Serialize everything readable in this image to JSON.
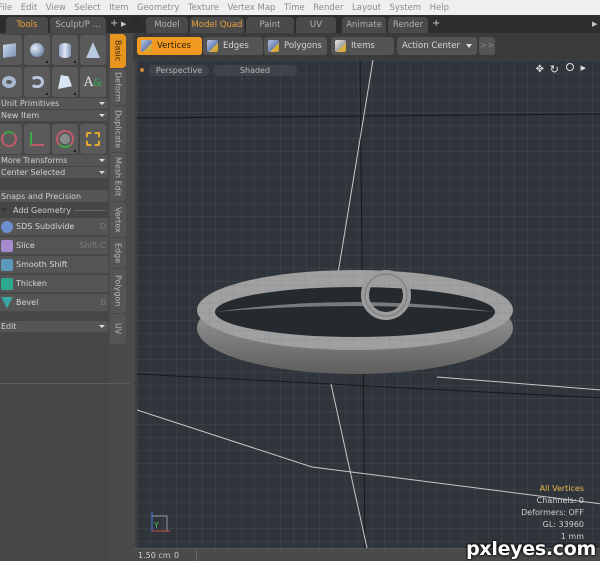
{
  "menubar": {
    "items": [
      "File",
      "Edit",
      "View",
      "Select",
      "Item",
      "Geometry",
      "Texture",
      "Vertex Map",
      "Time",
      "Render",
      "Layout",
      "System",
      "Help"
    ]
  },
  "left_tabs": {
    "items": [
      {
        "label": "Tools",
        "active": true
      },
      {
        "label": "Sculpt/P ...",
        "active": false
      }
    ]
  },
  "layout_tabs": {
    "items": [
      {
        "label": "Model",
        "active": false
      },
      {
        "label": "Model Quad",
        "active": true
      },
      {
        "label": "Paint",
        "active": false
      },
      {
        "label": "UV",
        "active": false
      },
      {
        "label": "Animate",
        "active": false
      },
      {
        "label": "Render",
        "active": false
      }
    ],
    "add_label": "+"
  },
  "toolbox": {
    "primitives_row1": [
      "cube-icon",
      "sphere-icon",
      "cylinder-icon",
      "cone-icon"
    ],
    "primitives_row2": [
      "torus-icon",
      "tube-icon",
      "pen-icon",
      "text-icon"
    ],
    "unit_primitives": "Unit Primitives",
    "new_item": "New Item",
    "transforms_row": [
      "move-icon",
      "transform-icon",
      "rotate-icon",
      "scale-icon"
    ],
    "more_transforms": "More Transforms",
    "center_selected": "Center Selected",
    "snaps_label": "Snaps and Precision",
    "add_geometry_label": "Add Geometry",
    "tools": [
      {
        "label": "SDS Subdivide",
        "key": "D",
        "color": "#6c8fd0"
      },
      {
        "label": "Slice",
        "key": "Shift-C",
        "color": "#a58ad0"
      },
      {
        "label": "Smooth Shift",
        "key": "",
        "color": "#5a9ab8"
      },
      {
        "label": "Thicken",
        "key": "",
        "color": "#2fa890"
      },
      {
        "label": "Bevel",
        "key": "B",
        "color": "#3aa8a8"
      }
    ],
    "edit_dropdown": "Edit"
  },
  "vertical_tabs": {
    "items": [
      {
        "label": "Basic",
        "active": true
      },
      {
        "label": "Deform",
        "active": false
      },
      {
        "label": "Duplicate",
        "active": false
      },
      {
        "label": "Mesh Edit",
        "active": false
      },
      {
        "label": "Vertex",
        "active": false
      },
      {
        "label": "Edge",
        "active": false
      },
      {
        "label": "Polygon",
        "active": false
      },
      {
        "label": "UV",
        "active": false
      }
    ]
  },
  "selection_modes": {
    "vertices": "Vertices",
    "edges": "Edges",
    "polygons": "Polygons",
    "items": "Items",
    "action_center": "Action Center",
    "more": ">>"
  },
  "viewport": {
    "view_type": "Perspective",
    "shading": "Shaded",
    "hud": {
      "selection": "All Vertices",
      "channels": "Channels: 0",
      "deformers": "Deformers: OFF",
      "gl": "GL: 33960",
      "unit": "1 mm"
    },
    "axis_label": "Y"
  },
  "statusbar": {
    "grid_size": "1.50 cm",
    "value": "0"
  },
  "watermark": "pxleyes.com",
  "colors": {
    "accent": "#f09a21",
    "active_tab_text": "#e8a23a",
    "viewport_bg": "#2f353a",
    "hud_selection": "#e8b64a"
  }
}
